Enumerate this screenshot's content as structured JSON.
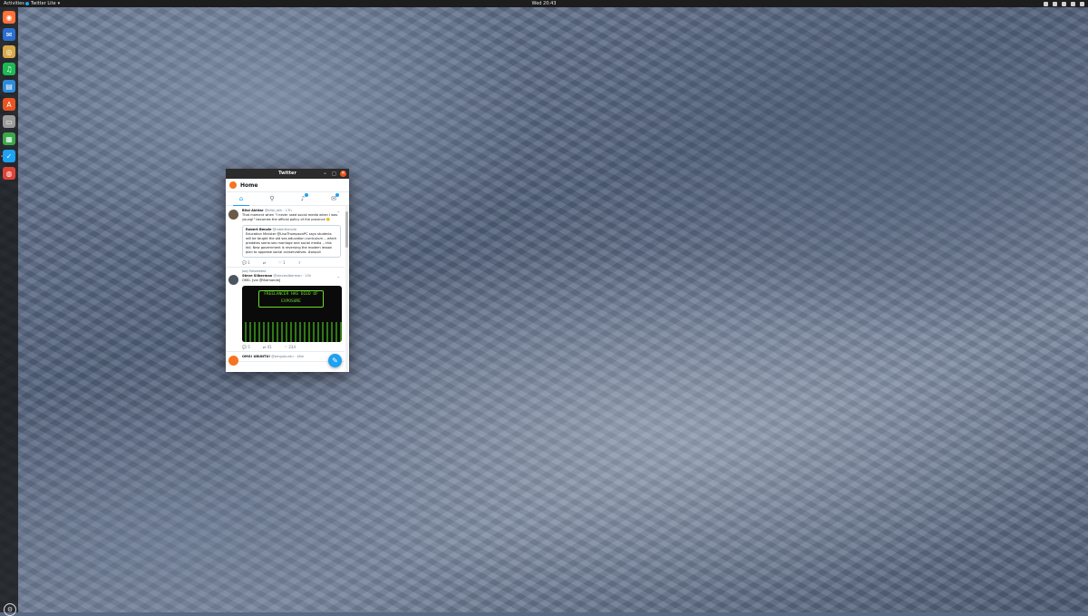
{
  "topbar": {
    "activities": "Activities",
    "app_menu": "Twitter Lite",
    "app_menu_arrow": "▾",
    "clock": "Wed 20:43"
  },
  "dock": {
    "items": [
      {
        "name": "firefox-icon",
        "color": "#ff7139"
      },
      {
        "name": "thunderbird-icon",
        "color": "#2a6fd1"
      },
      {
        "name": "rhythmbox-icon",
        "color": "#d7a94a"
      },
      {
        "name": "spotify-icon",
        "color": "#1db954"
      },
      {
        "name": "libreoffice-writer-icon",
        "color": "#2e8bd8"
      },
      {
        "name": "ubuntu-software-icon",
        "color": "#e95420"
      },
      {
        "name": "files-icon",
        "color": "#9a9a9a"
      },
      {
        "name": "libreoffice-calc-icon",
        "color": "#3aa84a"
      },
      {
        "name": "twitter-icon",
        "color": "#1da1f2"
      },
      {
        "name": "chrome-icon",
        "color": "#db4437"
      }
    ],
    "show_apps": "⚙"
  },
  "window": {
    "title": "Twitter",
    "min": "–",
    "max": "▢",
    "close": "✕"
  },
  "app": {
    "header_title": "Home",
    "tabs": [
      {
        "name": "home-tab",
        "glyph": "⌂"
      },
      {
        "name": "search-tab",
        "glyph": "⚲"
      },
      {
        "name": "notifications-tab",
        "glyph": "♪"
      },
      {
        "name": "messages-tab",
        "glyph": "✉"
      }
    ]
  },
  "tweets": [
    {
      "name": "Bilal Akhtar",
      "handle": "@bilal_akh",
      "time": "· 17h",
      "text": "That moment when \"I never used social media when I was young!\" becomes the official policy of the province 🙂",
      "quote": {
        "name": "Robert Benzie",
        "handle": "@robertbenzie",
        "text": "Education Minister @LisaThompsonPC says students will be taught the old sex-education curriculum -- which predates same-sex marriage and social media -- this fall. New government is reversing the modern lesson plan to appease social conservatives. #onpoli"
      },
      "replies": "1",
      "retweets": "",
      "likes": "1"
    },
    {
      "retweeted_by": "Joey Retweeted",
      "name": "Steve Silberman",
      "handle": "@stevesilberman",
      "time": "· 13h",
      "text": "OMG. [via @thamanda]",
      "media_text": "FREELANCER HAS DIED OF EXPOSURE",
      "replies": "5",
      "retweets": "41",
      "likes": "234"
    },
    {
      "name": "OMG! UBUNTU!",
      "handle": "@omgubuntu",
      "time": "· 18m"
    }
  ],
  "fab": "✎"
}
